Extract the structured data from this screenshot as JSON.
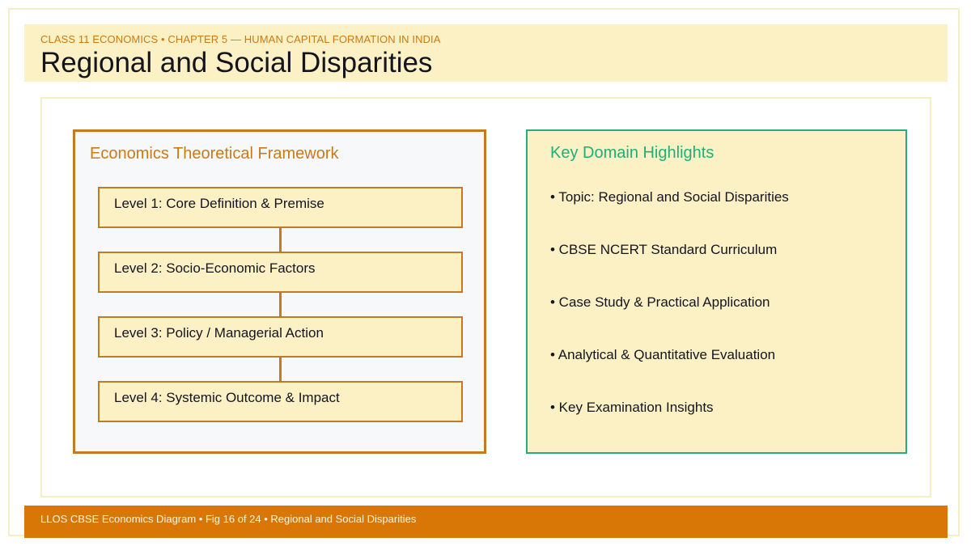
{
  "header": {
    "kicker": "CLASS 11 ECONOMICS • CHAPTER 5 — HUMAN CAPITAL FORMATION IN INDIA",
    "title": "Regional and Social Disparities"
  },
  "framework": {
    "title": "Economics Theoretical Framework",
    "levels": [
      {
        "label": "Level 1: Core Definition & Premise"
      },
      {
        "label": "Level 2: Socio-Economic Factors"
      },
      {
        "label": "Level 3: Policy / Managerial Action"
      },
      {
        "label": "Level 4: Systemic Outcome & Impact"
      }
    ]
  },
  "highlights": {
    "title": "Key Domain Highlights",
    "items": [
      "• Topic: Regional and Social Disparities",
      "• CBSE NCERT Standard Curriculum",
      "• Case Study & Practical Application",
      "• Analytical & Quantitative Evaluation",
      "• Key Examination Insights"
    ]
  },
  "footer": {
    "text": "LLOS CBSE Economics Diagram • Fig 16 of 24 • Regional and Social Disparities"
  },
  "colors": {
    "header_bg": "#fcf1c4",
    "accent_orange": "#c67a20",
    "accent_green": "#25ad7f",
    "footer_bg": "#d97706"
  }
}
